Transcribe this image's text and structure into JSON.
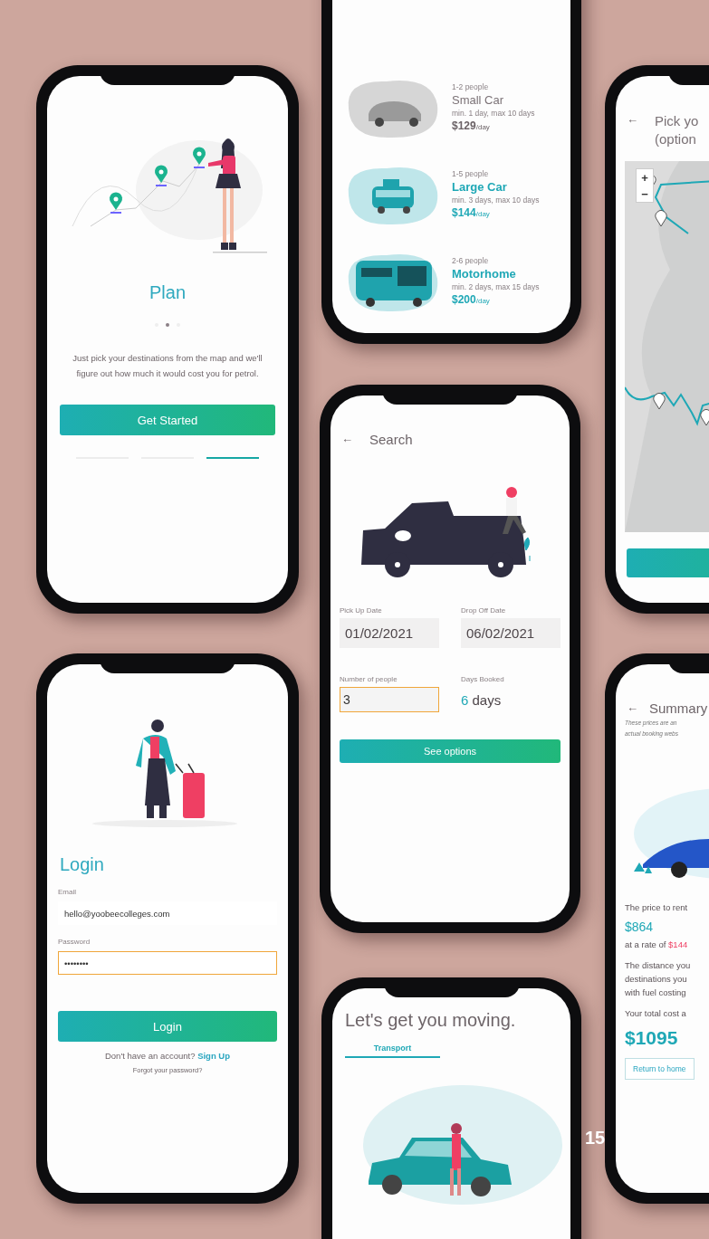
{
  "screens": [
    {
      "kind": "onboarding",
      "title": "Plan",
      "dots": [
        {
          "selected": false
        },
        {
          "selected": true
        },
        {
          "selected": false
        }
      ],
      "text": "Just pick your destinations from the map and we'll figure out how much it would cost you for petrol.",
      "button": "Get Started",
      "steps": [
        {
          "selected": false
        },
        {
          "selected": false
        },
        {
          "selected": true
        }
      ]
    },
    {
      "kind": "vehicles",
      "options": [
        {
          "people": "1-2 people",
          "name": "Small Car",
          "disabled": true,
          "limits": "min. 1 day, max 10 days",
          "price": "$129",
          "unit": "/day",
          "kind": "car"
        },
        {
          "people": "1-5 people",
          "name": "Large Car",
          "disabled": false,
          "limits": "min. 3 days, max 10 days",
          "price": "$144",
          "unit": "/day",
          "kind": "van"
        },
        {
          "people": "2-6 people",
          "name": "Motorhome",
          "disabled": false,
          "limits": "min. 2 days, max 15 days",
          "price": "$200",
          "unit": "/day",
          "kind": "bus"
        }
      ]
    },
    {
      "kind": "map",
      "back": "←",
      "title_lines": [
        "Pick yo",
        "(option"
      ],
      "zoom_in": "+",
      "zoom_out": "−"
    },
    {
      "kind": "search",
      "back": "←",
      "title": "Search",
      "dates": [
        {
          "label": "Pick Up Date",
          "value": "01/02/2021"
        },
        {
          "label": "Drop Off Date",
          "value": "06/02/2021"
        }
      ],
      "people": {
        "label": "Number of people",
        "value": "3",
        "focused": true
      },
      "days": {
        "label": "Days Booked",
        "value": "6",
        "unit": "days"
      },
      "button": "See options"
    },
    {
      "kind": "login",
      "title": "Login",
      "fields": [
        {
          "label": "Email",
          "value": "hello@yoobeecolleges.com",
          "focused": false
        },
        {
          "label": "Password",
          "value": "••••••••",
          "focused": true
        }
      ],
      "button": "Login",
      "signup_prompt": "Don't have an account?",
      "signup_link": "Sign Up",
      "forgot": "Forgot your password?"
    },
    {
      "kind": "transport",
      "title": "Let's get you moving.",
      "tabs": [
        {
          "label": "Transport",
          "selected": true
        }
      ]
    },
    {
      "kind": "summary",
      "back": "←",
      "title": "Summary",
      "note_lines": [
        "These prices are an",
        "actual booking webs"
      ],
      "rent_text": "The price to rent",
      "rent_price": "$864",
      "rate_prefix": "at a rate of",
      "rate": "$144",
      "distance_lines": [
        "The distance you",
        "destinations you",
        "with fuel costing"
      ],
      "total_text": "Your total cost a",
      "total": "$1095",
      "button": "Return to home"
    }
  ],
  "page_number": "15"
}
